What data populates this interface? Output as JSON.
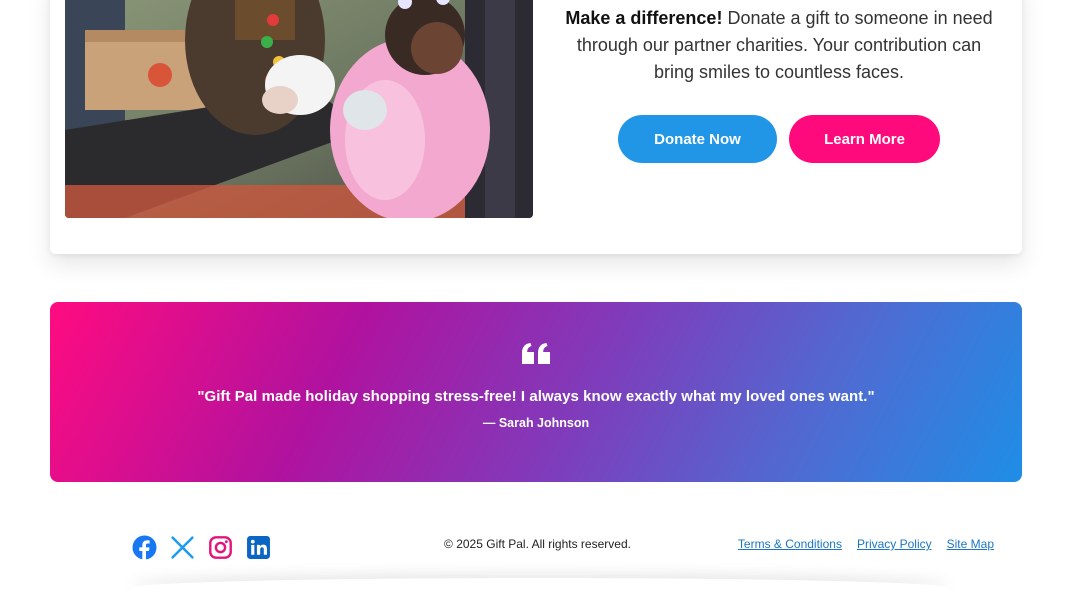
{
  "charity": {
    "photo_alt": "",
    "headline_bold": "Make a difference!",
    "headline_rest": " Donate a gift to someone in need through our partner charities. Your contribution can bring smiles to countless faces.",
    "donate_label": "Donate Now",
    "learn_label": "Learn More"
  },
  "testimonial": {
    "quote": "\"Gift Pal made holiday shopping stress-free! I always know exactly what my loved ones want.\"",
    "author": "— Sarah Johnson"
  },
  "footer": {
    "socials": [
      {
        "icon": "facebook-icon",
        "color": "#1877f2"
      },
      {
        "icon": "x-icon",
        "color": "#1d9bf0"
      },
      {
        "icon": "instagram-icon",
        "color": "#e4157a"
      },
      {
        "icon": "linkedin-icon",
        "color": "#0a66c2"
      }
    ],
    "copyright": "© 2025 Gift Pal. All rights reserved.",
    "links": [
      "Terms & Conditions",
      "Privacy Policy",
      "Site Map"
    ]
  },
  "colors": {
    "donate_button": "#2196e6",
    "learn_button": "#ff0a7c",
    "gradient_start": "#ff0b80",
    "gradient_end": "#1e8ee6",
    "link": "#1b76c2"
  }
}
